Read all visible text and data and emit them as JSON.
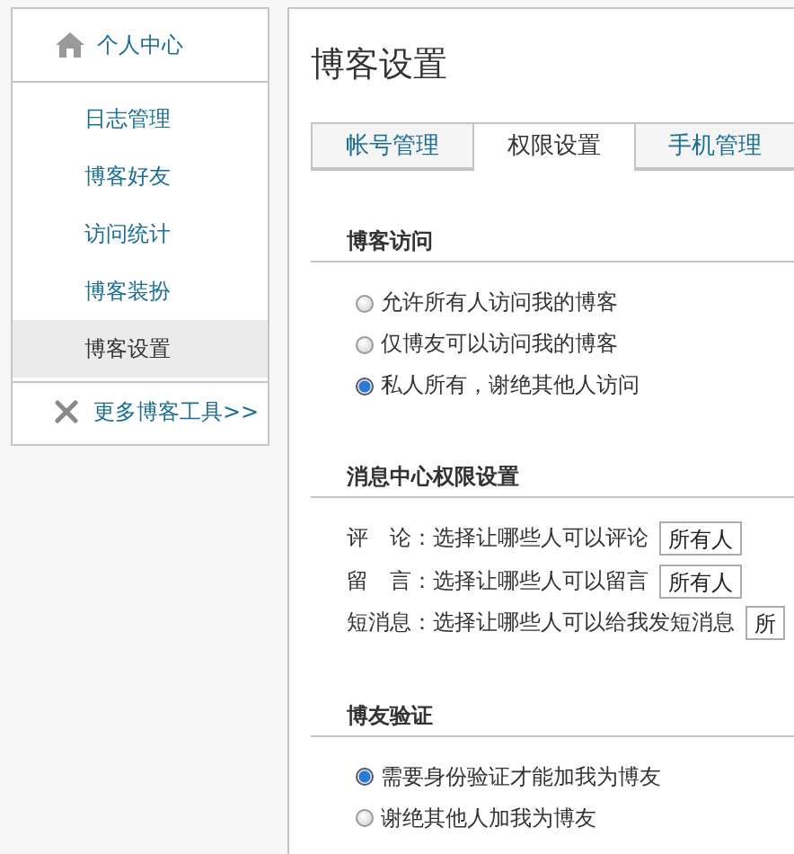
{
  "sidebar": {
    "header": "个人中心",
    "items": [
      {
        "label": "日志管理",
        "selected": false
      },
      {
        "label": "博客好友",
        "selected": false
      },
      {
        "label": "访问统计",
        "selected": false
      },
      {
        "label": "博客装扮",
        "selected": false
      },
      {
        "label": "博客设置",
        "selected": true
      }
    ],
    "footer": "更多博客工具>>"
  },
  "main": {
    "title": "博客设置",
    "tabs": [
      {
        "label": "帐号管理",
        "selected": false
      },
      {
        "label": "权限设置",
        "selected": true
      },
      {
        "label": "手机管理",
        "selected": false
      }
    ],
    "sections": [
      {
        "title": "博客访问",
        "kind": "radios",
        "options": [
          {
            "label": "允许所有人访问我的博客",
            "selected": false
          },
          {
            "label": "仅博友可以访问我的博客",
            "selected": false
          },
          {
            "label": "私人所有，谢绝其他人访问",
            "selected": true
          }
        ]
      },
      {
        "title": "消息中心权限设置",
        "kind": "selects",
        "rows": [
          {
            "label": "评　论：选择让哪些人可以评论",
            "value": "所有人"
          },
          {
            "label": "留　言：选择让哪些人可以留言",
            "value": "所有人"
          },
          {
            "label": "短消息：选择让哪些人可以给我发短消息",
            "value": "所"
          }
        ]
      },
      {
        "title": "博友验证",
        "kind": "radios",
        "options": [
          {
            "label": "需要身份验证才能加我为博友",
            "selected": true
          },
          {
            "label": "谢绝其他人加我为博友",
            "selected": false
          }
        ]
      }
    ]
  }
}
